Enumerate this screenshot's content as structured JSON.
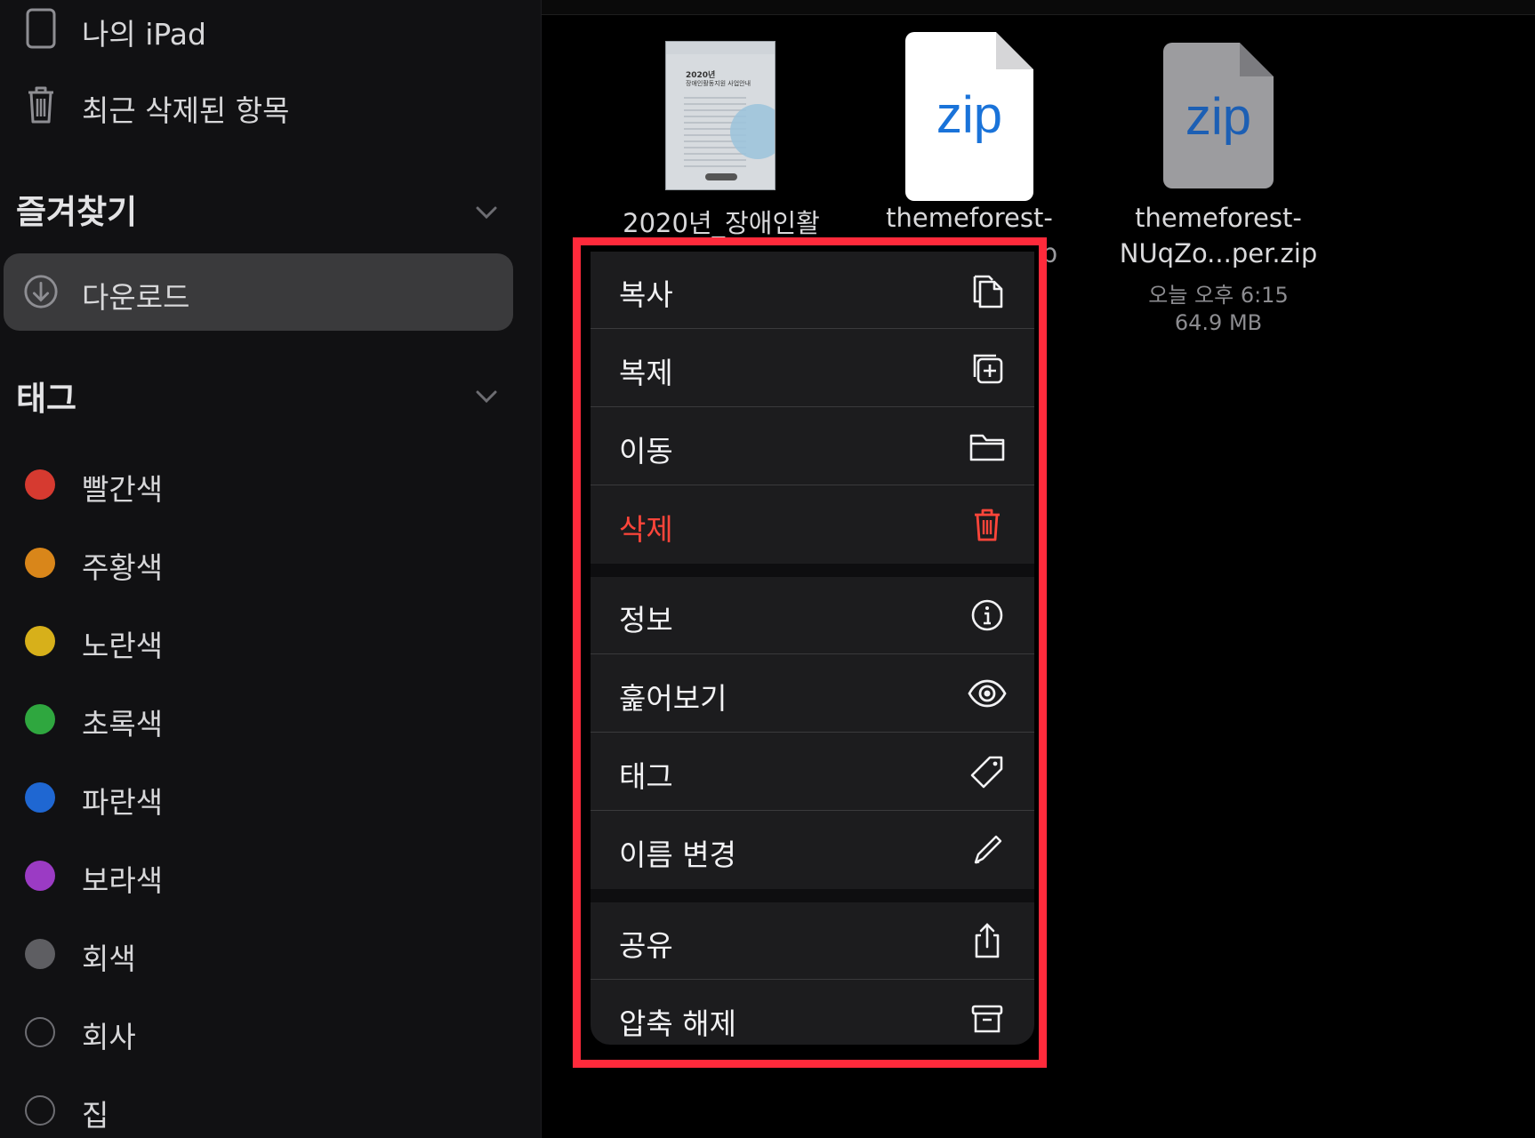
{
  "sidebar": {
    "locations": [
      {
        "label": "나의 iPad",
        "icon": "ipad-icon"
      },
      {
        "label": "최근 삭제된 항목",
        "icon": "trash-icon"
      }
    ],
    "favorites_title": "즐겨찾기",
    "favorites": [
      {
        "label": "다운로드",
        "icon": "download-icon",
        "selected": true
      }
    ],
    "tags_title": "태그",
    "tags": [
      {
        "label": "빨간색",
        "color": "#d63a30"
      },
      {
        "label": "주황색",
        "color": "#d9861a"
      },
      {
        "label": "노란색",
        "color": "#d7b01a"
      },
      {
        "label": "초록색",
        "color": "#2fa73f"
      },
      {
        "label": "파란색",
        "color": "#1f67d2"
      },
      {
        "label": "보라색",
        "color": "#9b3bc4"
      },
      {
        "label": "회색",
        "color": "#5e5e62"
      },
      {
        "label": "회사",
        "color": "none"
      },
      {
        "label": "집",
        "color": "none"
      }
    ]
  },
  "files": [
    {
      "name": "2020년_장애인활",
      "thumb_lines": [
        "2020년",
        "장애인활동지원 사업안내"
      ]
    },
    {
      "name": "themeforest-",
      "name_tail": "p",
      "icon_text": "zip"
    },
    {
      "name": "themeforest-",
      "name2": "NUqZo...per.zip",
      "date": "오늘 오후 6:15",
      "size": "64.9 MB",
      "icon_text": "zip"
    }
  ],
  "menu": {
    "groups": [
      [
        {
          "label": "복사",
          "icon": "copy-icon"
        },
        {
          "label": "복제",
          "icon": "duplicate-icon"
        },
        {
          "label": "이동",
          "icon": "folder-icon"
        },
        {
          "label": "삭제",
          "icon": "trash-icon",
          "destructive": true
        }
      ],
      [
        {
          "label": "정보",
          "icon": "info-icon"
        },
        {
          "label": "훑어보기",
          "icon": "eye-icon"
        },
        {
          "label": "태그",
          "icon": "tag-icon"
        },
        {
          "label": "이름 변경",
          "icon": "pencil-icon"
        }
      ],
      [
        {
          "label": "공유",
          "icon": "share-icon"
        },
        {
          "label": "압축 해제",
          "icon": "archive-icon"
        }
      ]
    ]
  },
  "colors": {
    "highlight": "#ff2a3b",
    "destructive": "#ff453a",
    "accent": "#1a73d9"
  }
}
